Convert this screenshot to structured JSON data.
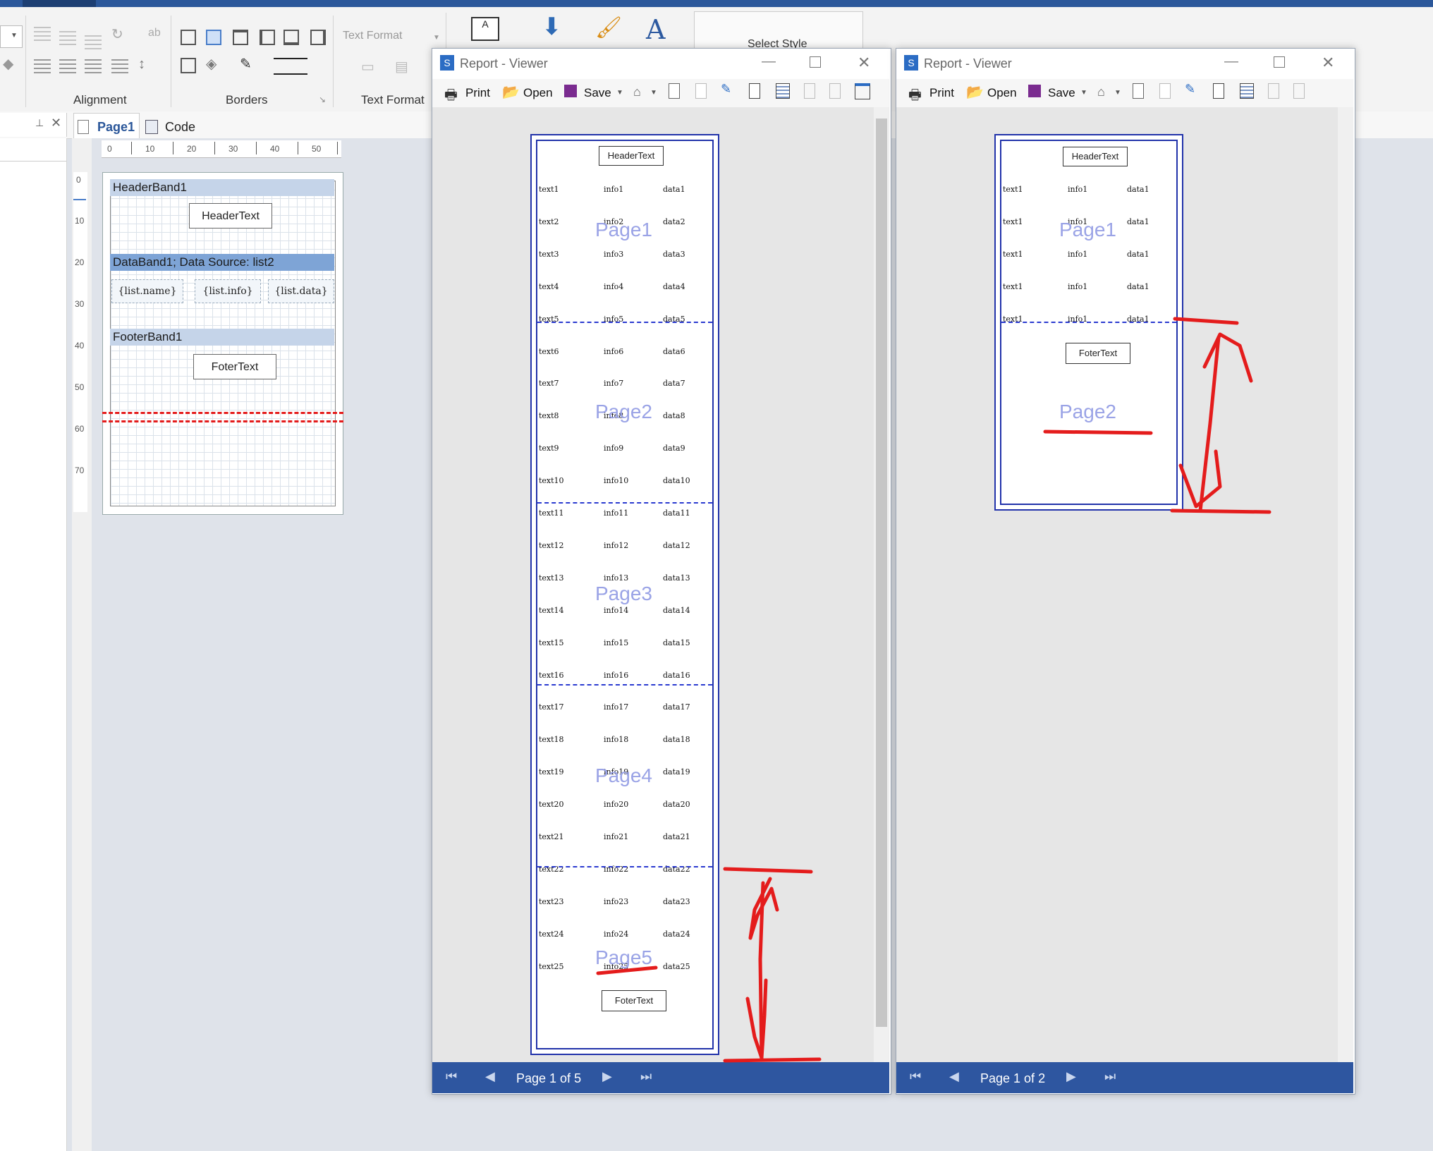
{
  "ribbon": {
    "groups": [
      {
        "label": "Alignment"
      },
      {
        "label": "Borders"
      },
      {
        "label": "Text Format"
      }
    ],
    "text_format_combo": "Text Format",
    "select_style": "Select Style"
  },
  "tabs": [
    {
      "label": "Page1"
    },
    {
      "label": "Code"
    }
  ],
  "ruler": {
    "h": [
      "0",
      "10",
      "20",
      "30",
      "40",
      "50"
    ],
    "v": [
      "0",
      "10",
      "20",
      "30",
      "40",
      "50",
      "60",
      "70"
    ]
  },
  "design": {
    "header_band": "HeaderBand1",
    "header_text": "HeaderText",
    "data_band": "DataBand1; Data Source: list2",
    "fields": [
      "{list.name}",
      "{list.info}",
      "{list.data}"
    ],
    "footer_band": "FooterBand1",
    "footer_text": "FoterText"
  },
  "viewer_left": {
    "title": "Report - Viewer",
    "toolbar": {
      "print": "Print",
      "open": "Open",
      "save": "Save"
    },
    "header_text": "HeaderText",
    "footer_text": "FoterText",
    "page_labels": [
      "Page1",
      "Page2",
      "Page3",
      "Page4",
      "Page5"
    ],
    "rows": [
      [
        "text1",
        "info1",
        "data1"
      ],
      [
        "text2",
        "info2",
        "data2"
      ],
      [
        "text3",
        "info3",
        "data3"
      ],
      [
        "text4",
        "info4",
        "data4"
      ],
      [
        "text5",
        "info5",
        "data5"
      ],
      [
        "text6",
        "info6",
        "data6"
      ],
      [
        "text7",
        "info7",
        "data7"
      ],
      [
        "text8",
        "info8",
        "data8"
      ],
      [
        "text9",
        "info9",
        "data9"
      ],
      [
        "text10",
        "info10",
        "data10"
      ],
      [
        "text11",
        "info11",
        "data11"
      ],
      [
        "text12",
        "info12",
        "data12"
      ],
      [
        "text13",
        "info13",
        "data13"
      ],
      [
        "text14",
        "info14",
        "data14"
      ],
      [
        "text15",
        "info15",
        "data15"
      ],
      [
        "text16",
        "info16",
        "data16"
      ],
      [
        "text17",
        "info17",
        "data17"
      ],
      [
        "text18",
        "info18",
        "data18"
      ],
      [
        "text19",
        "info19",
        "data19"
      ],
      [
        "text20",
        "info20",
        "data20"
      ],
      [
        "text21",
        "info21",
        "data21"
      ],
      [
        "text22",
        "info22",
        "data22"
      ],
      [
        "text23",
        "info23",
        "data23"
      ],
      [
        "text24",
        "info24",
        "data24"
      ],
      [
        "text25",
        "info25",
        "data25"
      ]
    ],
    "status": "Page 1 of 5"
  },
  "viewer_right": {
    "title": "Report - Viewer",
    "toolbar": {
      "print": "Print",
      "open": "Open",
      "save": "Save"
    },
    "header_text": "HeaderText",
    "footer_text": "FoterText",
    "page_labels": [
      "Page1",
      "Page2"
    ],
    "rows": [
      [
        "text1",
        "info1",
        "data1"
      ],
      [
        "text1",
        "info1",
        "data1"
      ],
      [
        "text1",
        "info1",
        "data1"
      ],
      [
        "text1",
        "info1",
        "data1"
      ],
      [
        "text1",
        "info1",
        "data1"
      ]
    ],
    "status": "Page 1 of 2"
  },
  "colors": {
    "accent": "#2b579a",
    "annotation": "#e41c1c",
    "report_border": "#2233aa"
  }
}
